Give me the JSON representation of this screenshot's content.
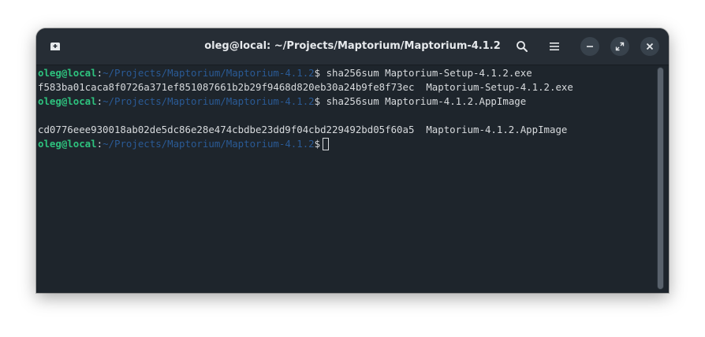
{
  "window": {
    "title": "oleg@local: ~/Projects/Maptorium/Maptorium-4.1.2"
  },
  "toolbar": {
    "new_tab_icon": "new-tab-icon",
    "search_icon": "search-icon",
    "menu_icon": "hamburger-menu-icon",
    "minimize_icon": "minimize-icon",
    "maximize_icon": "maximize-icon",
    "close_icon": "close-icon"
  },
  "terminal": {
    "lines": [
      {
        "type": "prompt",
        "user": "oleg@local",
        "sep": ":",
        "path": "~/Projects/Maptorium/Maptorium-4.1.2",
        "dollar": "$ ",
        "command": "sha256sum Maptorium-Setup-4.1.2.exe"
      },
      {
        "type": "output",
        "text": "f583ba01caca8f0726a371ef851087661b2b29f9468d820eb30a24b9fe8f73ec  Maptorium-Setup-4.1.2.exe"
      },
      {
        "type": "prompt",
        "user": "oleg@local",
        "sep": ":",
        "path": "~/Projects/Maptorium/Maptorium-4.1.2",
        "dollar": "$ ",
        "command": "sha256sum Maptorium-4.1.2.AppImage"
      },
      {
        "type": "output",
        "text": ""
      },
      {
        "type": "output",
        "text": "cd0776eee930018ab02de5dc86e28e474cbdbe23dd9f04cbd229492bd05f60a5  Maptorium-4.1.2.AppImage"
      },
      {
        "type": "prompt",
        "user": "oleg@local",
        "sep": ":",
        "path": "~/Projects/Maptorium/Maptorium-4.1.2",
        "dollar": "$",
        "command": ""
      }
    ]
  },
  "colors": {
    "background": "#1e252c",
    "titlebar": "#262d35",
    "prompt_user": "#2ec27e",
    "prompt_path": "#2a5a95",
    "text": "#d7dadd"
  }
}
